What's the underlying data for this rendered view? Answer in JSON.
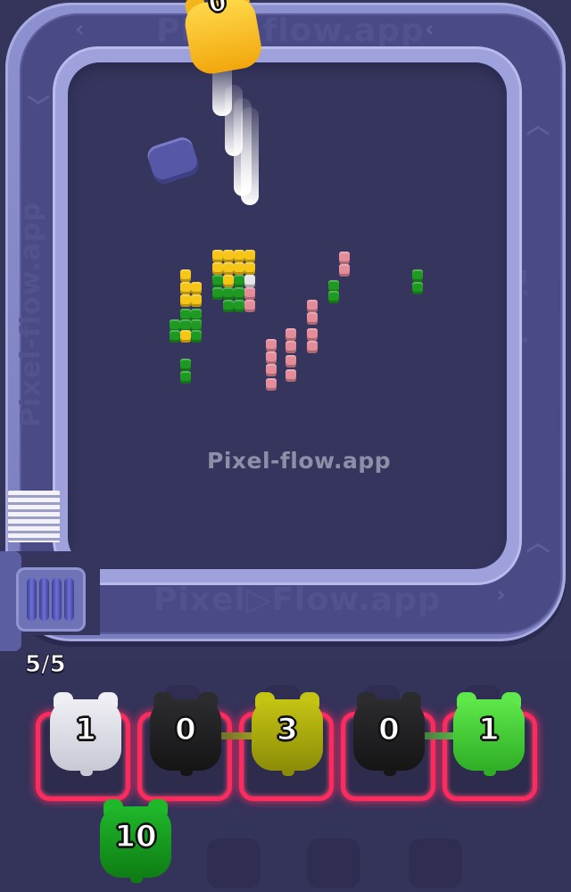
{
  "watermark": "Pixel-flow.app",
  "track_labels": {
    "top": "Pixel-flow.app",
    "bottom": "Pixel▷Flow.app",
    "left": "Pixel-flow.app",
    "right": "Pixel-flow.app"
  },
  "capacity_counter": "5/5",
  "shooter_top": {
    "count": "0",
    "color": "#f2b51c"
  },
  "queue_slots": [
    {
      "count": "1",
      "color": "#eeeef4",
      "shade": "#c9c9d6"
    },
    {
      "count": "0",
      "color": "#2c2c2e",
      "shade": "#151516"
    },
    {
      "count": "3",
      "color": "#c4c414",
      "shade": "#8c8c08"
    },
    {
      "count": "0",
      "color": "#2c2c2e",
      "shade": "#151516"
    },
    {
      "count": "1",
      "color": "#5ee84a",
      "shade": "#2fae26"
    }
  ],
  "next_shooter": {
    "count": "10",
    "color": "#1fb82a",
    "shade": "#0f7d15"
  },
  "colors": {
    "slot_border": "#ff2a5e",
    "pixel_yellow": "#f5c518",
    "pixel_green": "#1e9a23",
    "pixel_pink": "#e58c9a",
    "background": "#35345a"
  }
}
